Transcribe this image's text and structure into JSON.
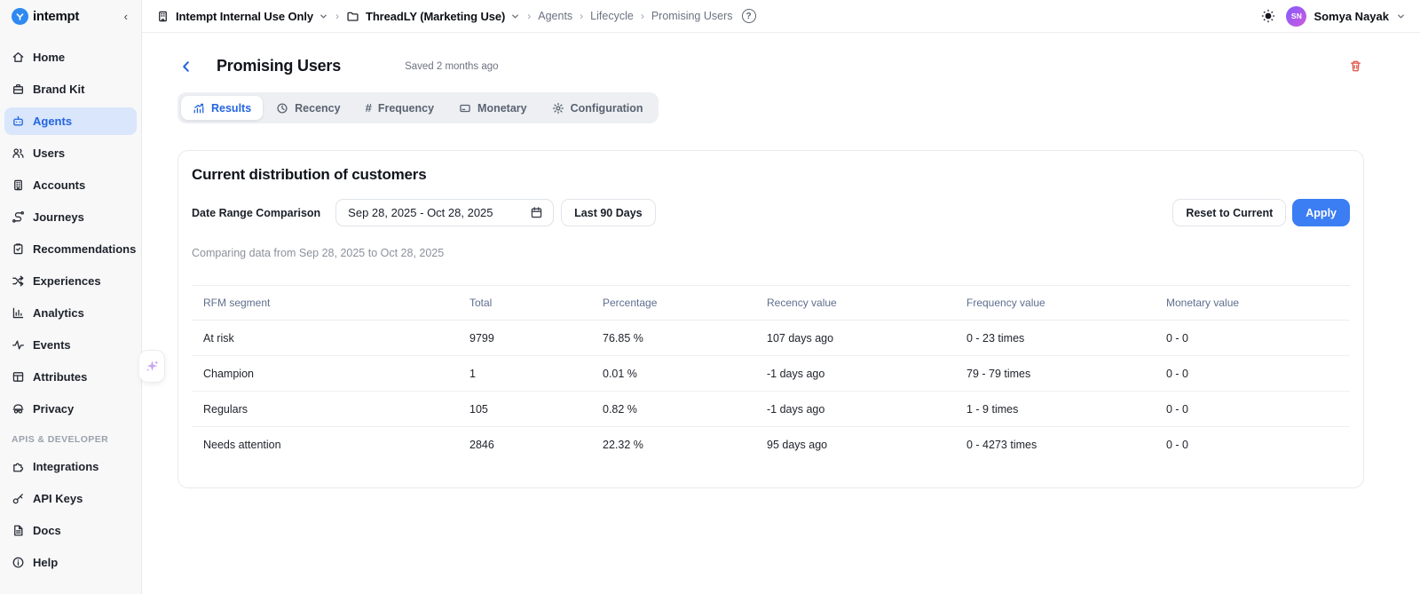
{
  "colors": {
    "accent": "#2465e0",
    "accent_soft": "#d9e6fb",
    "accent_strong": "#3b7df2",
    "danger": "#dd5448",
    "sparkle": "#c9a5ee"
  },
  "brand": {
    "name": "intempt"
  },
  "sidebar": {
    "items": [
      {
        "label": "Home",
        "icon": "home-icon"
      },
      {
        "label": "Brand Kit",
        "icon": "brand-kit-icon"
      },
      {
        "label": "Agents",
        "icon": "agents-icon",
        "active": true
      },
      {
        "label": "Users",
        "icon": "users-icon"
      },
      {
        "label": "Accounts",
        "icon": "accounts-icon"
      },
      {
        "label": "Journeys",
        "icon": "journeys-icon"
      },
      {
        "label": "Recommendations",
        "icon": "recommendations-icon"
      },
      {
        "label": "Experiences",
        "icon": "experiences-icon"
      },
      {
        "label": "Analytics",
        "icon": "analytics-icon"
      },
      {
        "label": "Events",
        "icon": "events-icon"
      },
      {
        "label": "Attributes",
        "icon": "attributes-icon"
      },
      {
        "label": "Privacy",
        "icon": "privacy-icon"
      }
    ],
    "section_label": "APIS & DEVELOPER",
    "dev_items": [
      {
        "label": "Integrations",
        "icon": "integrations-icon"
      },
      {
        "label": "API Keys",
        "icon": "api-keys-icon"
      },
      {
        "label": "Docs",
        "icon": "docs-icon"
      },
      {
        "label": "Help",
        "icon": "help-icon"
      }
    ]
  },
  "topbar": {
    "org": "Intempt Internal Use Only",
    "project": "ThreadLY (Marketing Use)",
    "breadcrumbs": [
      "Agents",
      "Lifecycle",
      "Promising Users"
    ],
    "help_glyph": "?",
    "user": {
      "initials": "SN",
      "name": "Somya Nayak"
    }
  },
  "page": {
    "title": "Promising Users",
    "saved": "Saved 2 months ago",
    "tabs": [
      {
        "label": "Results",
        "active": true
      },
      {
        "label": "Recency"
      },
      {
        "label": "Frequency",
        "glyph": "#"
      },
      {
        "label": "Monetary"
      },
      {
        "label": "Configuration"
      }
    ]
  },
  "panel": {
    "title": "Current distribution of customers",
    "date_label": "Date Range Comparison",
    "date_value": "Sep 28, 2025 - Oct 28, 2025",
    "quick_range": "Last 90 Days",
    "reset_label": "Reset to Current",
    "apply_label": "Apply",
    "comparing_note": "Comparing data from Sep 28, 2025 to Oct 28, 2025",
    "table": {
      "columns": [
        "RFM segment",
        "Total",
        "Percentage",
        "Recency value",
        "Frequency value",
        "Monetary value"
      ],
      "rows": [
        [
          "At risk",
          "9799",
          "76.85 %",
          "107 days ago",
          "0 - 23 times",
          "0 - 0"
        ],
        [
          "Champion",
          "1",
          "0.01 %",
          "-1 days ago",
          "79 - 79 times",
          "0 - 0"
        ],
        [
          "Regulars",
          "105",
          "0.82 %",
          "-1 days ago",
          "1 - 9 times",
          "0 - 0"
        ],
        [
          "Needs attention",
          "2846",
          "22.32 %",
          "95 days ago",
          "0 - 4273 times",
          "0 - 0"
        ]
      ]
    }
  }
}
